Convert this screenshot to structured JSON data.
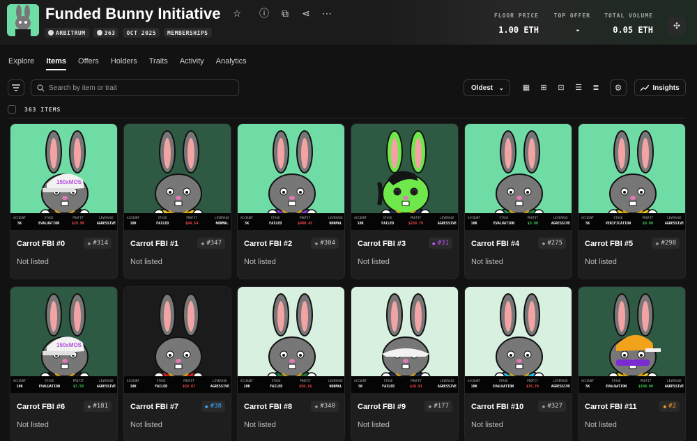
{
  "collection": {
    "title": "Funded Bunny Initiative",
    "chips": [
      "ARBITRUM",
      "363",
      "OCT 2025",
      "MEMBERSHIPS"
    ]
  },
  "stats": [
    {
      "label": "FLOOR PRICE",
      "value": "1.00 ETH"
    },
    {
      "label": "TOP OFFER",
      "value": "-"
    },
    {
      "label": "TOTAL VOLUME",
      "value": "0.05 ETH"
    }
  ],
  "tabs": [
    {
      "label": "Explore",
      "active": false
    },
    {
      "label": "Items",
      "active": true
    },
    {
      "label": "Offers",
      "active": false
    },
    {
      "label": "Holders",
      "active": false
    },
    {
      "label": "Traits",
      "active": false
    },
    {
      "label": "Activity",
      "active": false
    },
    {
      "label": "Analytics",
      "active": false
    }
  ],
  "search": {
    "placeholder": "Search by item or trait"
  },
  "sort": {
    "label": "Oldest"
  },
  "insights_label": "Insights",
  "items_count": "363 ITEMS",
  "hud_labels": {
    "account": "ACCOUNT",
    "stage": "STAGE",
    "profit": "PROFIT",
    "leverage": "LEVERAGE"
  },
  "items": [
    {
      "name": "Carrot FBI #0",
      "rank": "#314",
      "rank_color": "#9a9a9a",
      "status": "Not listed",
      "bg": "#6fdca5",
      "body": "#777777",
      "shirt": "#1a1a1a",
      "hat": "white",
      "account": "5K",
      "stage": "EVALUATION",
      "profit": "$29.98",
      "profit_color": "#ff4d4d",
      "leverage": "AGRESSIVE"
    },
    {
      "name": "Carrot FBI #1",
      "rank": "#347",
      "rank_color": "#9a9a9a",
      "status": "Not listed",
      "bg": "#2e5a44",
      "body": "#777777",
      "shirt": "#e6c21b",
      "hat": "",
      "account": "10K",
      "stage": "FAILED",
      "profit": "$94.54",
      "profit_color": "#ff4d4d",
      "leverage": "NORMAL"
    },
    {
      "name": "Carrot FBI #2",
      "rank": "#304",
      "rank_color": "#9a9a9a",
      "status": "Not listed",
      "bg": "#6fdca5",
      "body": "#777777",
      "shirt": "#7a3dcf",
      "hat": "",
      "account": "5K",
      "stage": "FAILED",
      "profit": "$480.45",
      "profit_color": "#ff4d4d",
      "leverage": "NORMAL"
    },
    {
      "name": "Carrot FBI #3",
      "rank": "#31",
      "rank_color": "#c455ff",
      "status": "Not listed",
      "bg": "#2e5a44",
      "body": "#6ee84a",
      "shirt": "#1f2d55",
      "hat": "hair",
      "account": "10K",
      "stage": "FAILED",
      "profit": "$258.79",
      "profit_color": "#ff4d4d",
      "leverage": "AGRESSIVE"
    },
    {
      "name": "Carrot FBI #4",
      "rank": "#275",
      "rank_color": "#9a9a9a",
      "status": "Not listed",
      "bg": "#6fdca5",
      "body": "#777777",
      "shirt": "#1f8f50",
      "hat": "",
      "account": "10K",
      "stage": "EVALUATION",
      "profit": "$3.80",
      "profit_color": "#39d353",
      "leverage": "AGRESSIVE"
    },
    {
      "name": "Carrot FBI #5",
      "rank": "#298",
      "rank_color": "#9a9a9a",
      "status": "Not listed",
      "bg": "#6fdca5",
      "body": "#777777",
      "shirt": "#e6c21b",
      "hat": "",
      "account": "5K",
      "stage": "VERIFICATION",
      "profit": "$0.00",
      "profit_color": "#39d353",
      "leverage": "AGRESSIVE"
    },
    {
      "name": "Carrot FBI #6",
      "rank": "#181",
      "rank_color": "#9a9a9a",
      "status": "Not listed",
      "bg": "#2e5a44",
      "body": "#777777",
      "shirt": "#1a1a1a",
      "hat": "white",
      "account": "10K",
      "stage": "EVALUATION",
      "profit": "$7.50",
      "profit_color": "#39d353",
      "leverage": "AGRESSIVE"
    },
    {
      "name": "Carrot FBI #7",
      "rank": "#38",
      "rank_color": "#3ea8ff",
      "status": "Not listed",
      "bg": "#1b1b1b",
      "body": "#777777",
      "shirt": "#d11e1e",
      "hat": "",
      "account": "10K",
      "stage": "FAILED",
      "profit": "$58.07",
      "profit_color": "#ff4d4d",
      "leverage": "AGRESSIVE"
    },
    {
      "name": "Carrot FBI #8",
      "rank": "#340",
      "rank_color": "#9a9a9a",
      "status": "Not listed",
      "bg": "#d8f0df",
      "body": "#777777",
      "shirt": "#1f7a44",
      "hat": "",
      "account": "10K",
      "stage": "FAILED",
      "profit": "$56.16",
      "profit_color": "#ff4d4d",
      "leverage": "NORMAL"
    },
    {
      "name": "Carrot FBI #9",
      "rank": "#177",
      "rank_color": "#9a9a9a",
      "status": "Not listed",
      "bg": "#d8f0df",
      "body": "#777777",
      "shirt": "#1f2d55",
      "hat": "visor",
      "account": "5K",
      "stage": "FAILED",
      "profit": "$26.91",
      "profit_color": "#ff4d4d",
      "leverage": "AGRESSIVE"
    },
    {
      "name": "Carrot FBI #10",
      "rank": "#327",
      "rank_color": "#9a9a9a",
      "status": "Not listed",
      "bg": "#d8f0df",
      "body": "#777777",
      "shirt": "#2bb8e0",
      "hat": "",
      "account": "10K",
      "stage": "EVALUATION",
      "profit": "$76.74",
      "profit_color": "#ff4d4d",
      "leverage": "AGRESSIVE"
    },
    {
      "name": "Carrot FBI #11",
      "rank": "#2",
      "rank_color": "#ff9a1f",
      "status": "Not listed",
      "bg": "#2e5a44",
      "body": "#777777",
      "shirt": "#e6c21b",
      "hat": "orange",
      "account": "5K",
      "stage": "EVALUATION",
      "profit": "$100.00",
      "profit_color": "#39d353",
      "leverage": "AGRESSIVE"
    }
  ]
}
